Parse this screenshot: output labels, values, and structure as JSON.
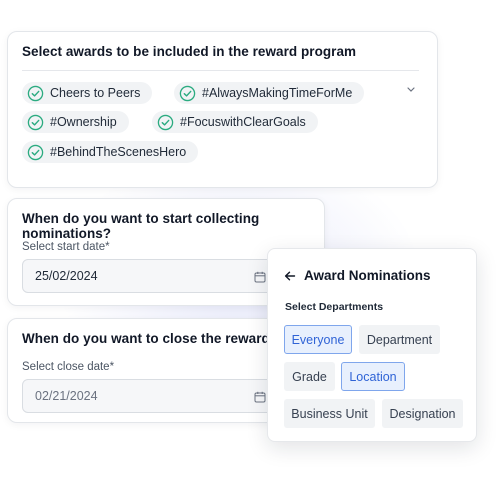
{
  "awards": {
    "title": "Select awards to be included in the reward program",
    "chips": [
      "Cheers to Peers",
      "#AlwaysMakingTimeForMe",
      "#Ownership",
      "#FocuswithClearGoals",
      "#BehindTheScenesHero"
    ]
  },
  "start": {
    "title": "When do you want to start collecting nominations?",
    "label": "Select start date*",
    "value": "25/02/2024"
  },
  "close": {
    "title": "When do you want to close the reward cycle?",
    "label": "Select close date*",
    "placeholder": "02/21/2024"
  },
  "popup": {
    "title": "Award Nominations",
    "subtitle": "Select Departments",
    "departments": [
      "Everyone",
      "Department",
      "Grade",
      "Location",
      "Business Unit",
      "Designation"
    ],
    "selected": [
      "Everyone",
      "Location"
    ]
  },
  "colors": {
    "check": "#2bab80",
    "selected_border": "#7fa6ec",
    "selected_text": "#2f63d6"
  }
}
